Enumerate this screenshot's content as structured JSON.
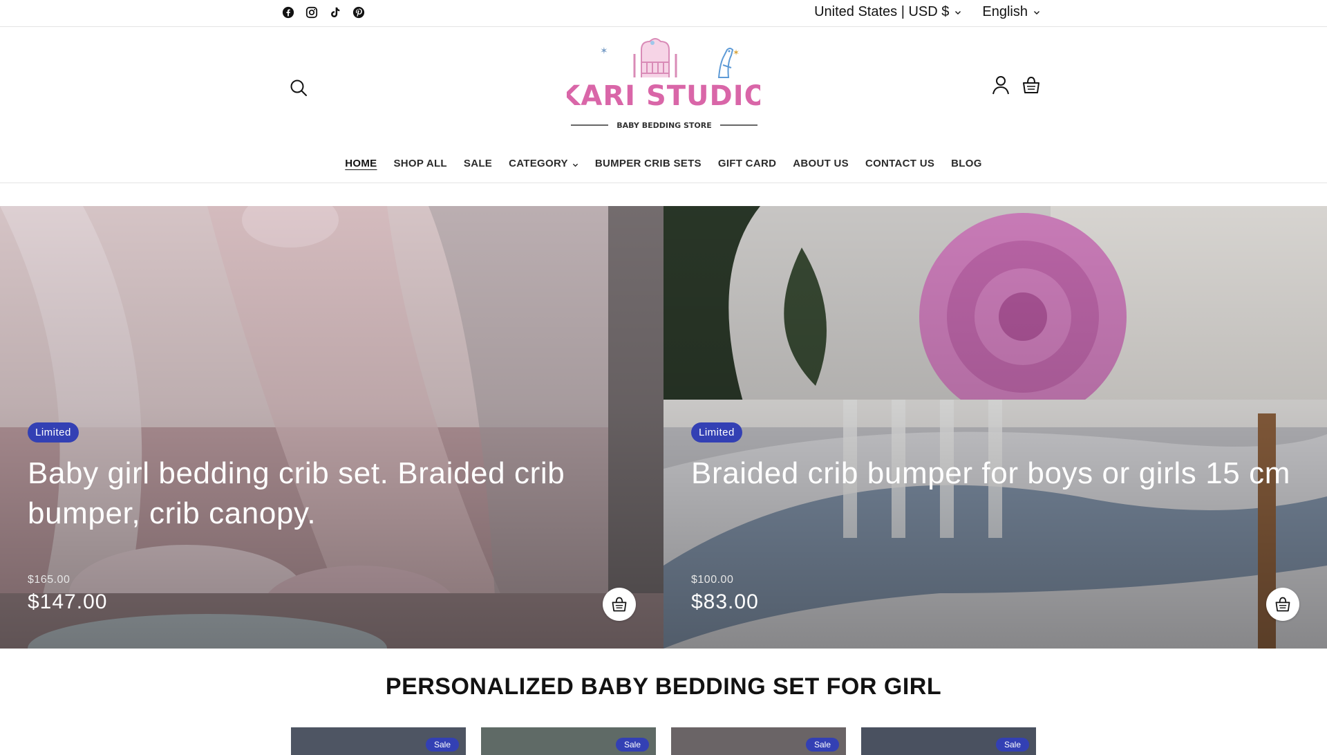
{
  "utility": {
    "social_icons": [
      "facebook-icon",
      "instagram-icon",
      "tiktok-icon",
      "pinterest-icon"
    ],
    "country_currency": "United States | USD $",
    "language": "English"
  },
  "header": {
    "logo_text": "KARI STUDIO",
    "logo_tagline": "BABY BEDDING STORE",
    "icons": [
      "search-icon",
      "account-icon",
      "cart-icon"
    ]
  },
  "nav": {
    "items": [
      {
        "label": "HOME",
        "active": true
      },
      {
        "label": "SHOP ALL"
      },
      {
        "label": "SALE"
      },
      {
        "label": "CATEGORY",
        "dropdown": true
      },
      {
        "label": "BUMPER CRIB SETS"
      },
      {
        "label": "GIFT CARD"
      },
      {
        "label": "ABOUT US"
      },
      {
        "label": "CONTACT US"
      },
      {
        "label": "BLOG"
      }
    ]
  },
  "hero": {
    "products": [
      {
        "badge": "Limited",
        "title": "Baby girl bedding crib set. Braided crib bumper, crib canopy.",
        "compare_price": "$165.00",
        "price": "$147.00"
      },
      {
        "badge": "Limited",
        "title": "Braided crib bumper for boys or girls 15 cm",
        "compare_price": "$100.00",
        "price": "$83.00"
      }
    ]
  },
  "collection": {
    "heading": "PERSONALIZED BABY BEDDING SET FOR GIRL",
    "cards": [
      {
        "badge": "Sale"
      },
      {
        "badge": "Sale"
      },
      {
        "badge": "Sale"
      },
      {
        "badge": "Sale"
      }
    ]
  },
  "colors": {
    "badge_blue": "#3340b4",
    "logo_pink": "#d966a8",
    "text": "#121212"
  }
}
